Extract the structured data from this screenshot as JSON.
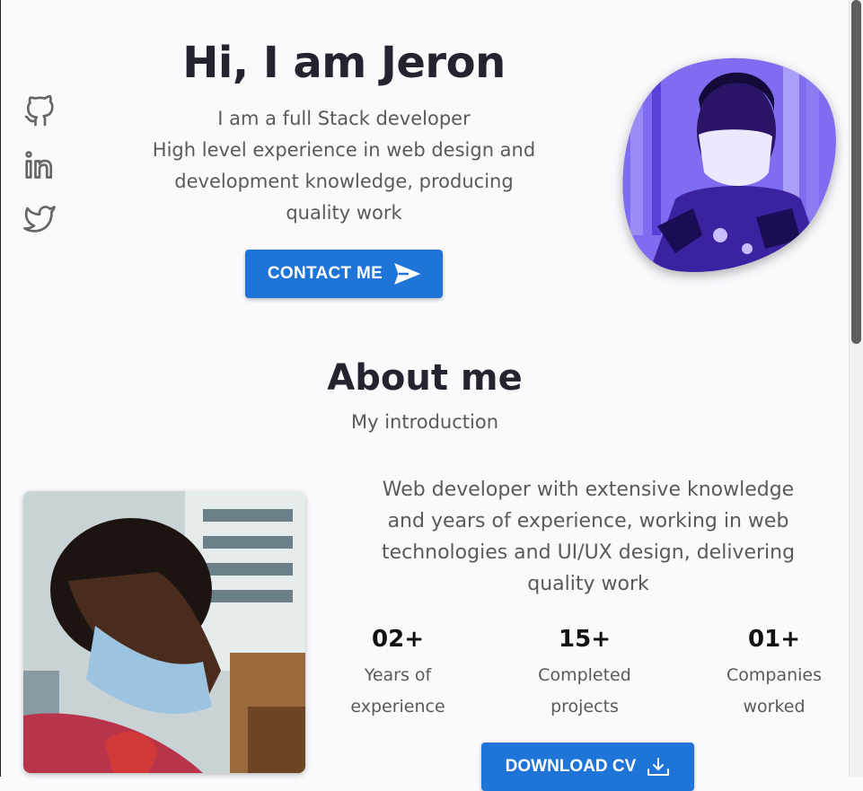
{
  "hero": {
    "title": "Hi, I am Jeron",
    "subtitle_lines": [
      "I am a full Stack developer",
      "High level experience in web design and",
      "development knowledge, producing",
      "quality work"
    ],
    "contact_button": "CONTACT ME"
  },
  "socials": [
    {
      "icon": "github-icon"
    },
    {
      "icon": "linkedin-icon"
    },
    {
      "icon": "twitter-icon"
    }
  ],
  "about": {
    "title": "About me",
    "subtitle": "My introduction",
    "description_lines": [
      "Web developer with extensive knowledge",
      "and years of experience, working in web",
      "technologies and UI/UX design, delivering",
      "quality work"
    ],
    "stats": [
      {
        "number": "02+",
        "label_lines": [
          "Years of",
          "experience"
        ]
      },
      {
        "number": "15+",
        "label_lines": [
          "Completed",
          "projects"
        ]
      },
      {
        "number": "01+",
        "label_lines": [
          "Companies",
          "worked"
        ]
      }
    ],
    "download_button": "DOWNLOAD CV"
  },
  "colors": {
    "accent": "#1f74d8",
    "blob_tint": "#5b3fe0",
    "heading": "#25232f",
    "text": "#5a5a5a"
  }
}
